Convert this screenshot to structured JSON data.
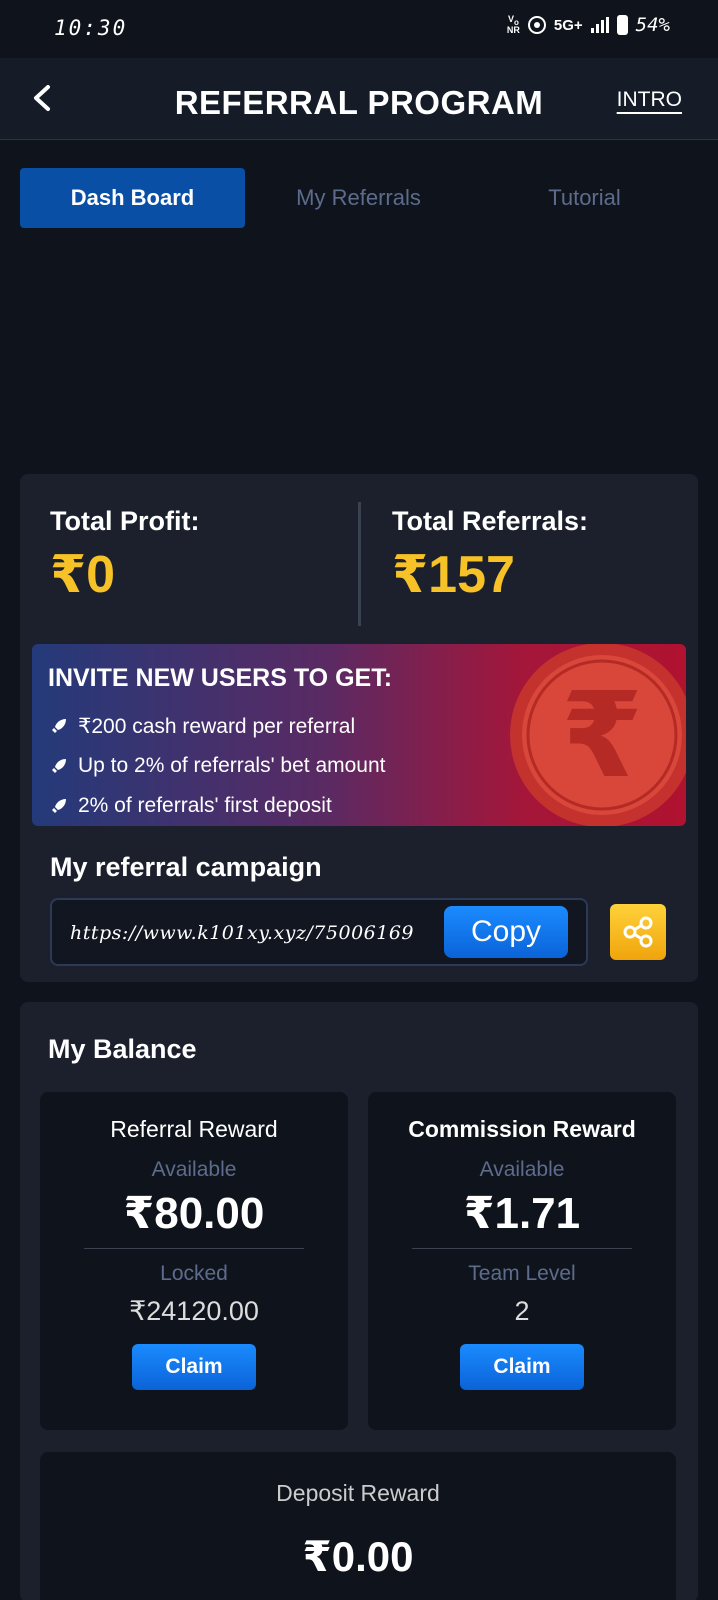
{
  "status_bar": {
    "time": "10:30",
    "vonr": "Vo NR",
    "network": "5G+",
    "battery": "54%"
  },
  "header": {
    "title": "REFERRAL PROGRAM",
    "intro": "INTRO"
  },
  "tabs": [
    {
      "label": "Dash Board",
      "active": true
    },
    {
      "label": "My Referrals",
      "active": false
    },
    {
      "label": "Tutorial",
      "active": false
    }
  ],
  "stats": {
    "profit_label": "Total Profit:",
    "profit_value": "₹0",
    "referrals_label": "Total Referrals:",
    "referrals_value": "₹157"
  },
  "banner": {
    "heading": "INVITE NEW USERS TO GET:",
    "points": [
      "₹200 cash reward per referral",
      "Up to 2% of referrals' bet amount",
      "2% of referrals' first deposit"
    ]
  },
  "campaign": {
    "title": "My referral campaign",
    "link": "https://www.k101xy.xyz/75006169",
    "copy_label": "Copy"
  },
  "balance": {
    "title": "My Balance",
    "referral": {
      "title": "Referral Reward",
      "available_label": "Available",
      "available_value": "₹80.00",
      "sub_label": "Locked",
      "sub_value": "₹24120.00",
      "claim_label": "Claim"
    },
    "commission": {
      "title": "Commission Reward",
      "available_label": "Available",
      "available_value": "₹1.71",
      "sub_label": "Team Level",
      "sub_value": "2",
      "claim_label": "Claim"
    },
    "deposit": {
      "title": "Deposit Reward",
      "value": "₹0.00"
    }
  },
  "colors": {
    "background": "#0f141c",
    "card": "#1b202c",
    "accent_blue": "#0a4fa6",
    "gold": "#f7c227"
  }
}
